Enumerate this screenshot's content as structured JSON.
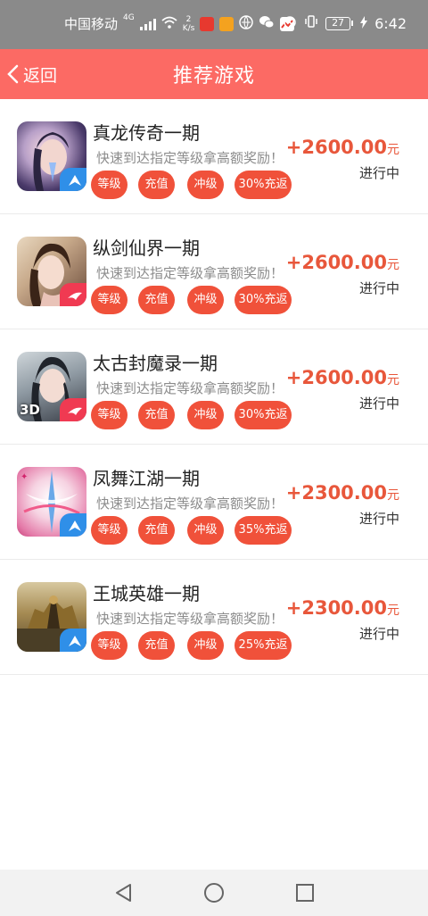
{
  "status_bar": {
    "carrier": "中国移动",
    "network": "4G",
    "speed_value": "2",
    "speed_unit": "K/s",
    "battery": "27",
    "time": "6:42"
  },
  "header": {
    "back_label": "返回",
    "title": "推荐游戏"
  },
  "games": [
    {
      "name": "真龙传奇一期",
      "desc": "快速到达指定等级拿高额奖励！",
      "tags": [
        "等级",
        "充值",
        "冲级",
        "30%充返"
      ],
      "amount": "+2600.00",
      "unit": "元",
      "status": "进行中"
    },
    {
      "name": "纵剑仙界一期",
      "desc": "快速到达指定等级拿高额奖励！",
      "tags": [
        "等级",
        "充值",
        "冲级",
        "30%充返"
      ],
      "amount": "+2600.00",
      "unit": "元",
      "status": "进行中"
    },
    {
      "name": "太古封魔录一期",
      "desc": "快速到达指定等级拿高额奖励！",
      "tags": [
        "等级",
        "充值",
        "冲级",
        "30%充返"
      ],
      "amount": "+2600.00",
      "unit": "元",
      "status": "进行中",
      "icon_badge": "3D"
    },
    {
      "name": "凤舞江湖一期",
      "desc": "快速到达指定等级拿高额奖励！",
      "tags": [
        "等级",
        "充值",
        "冲级",
        "35%充返"
      ],
      "amount": "+2300.00",
      "unit": "元",
      "status": "进行中"
    },
    {
      "name": "王城英雄一期",
      "desc": "快速到达指定等级拿高额奖励！",
      "tags": [
        "等级",
        "充值",
        "冲级",
        "25%充返"
      ],
      "amount": "+2300.00",
      "unit": "元",
      "status": "进行中"
    }
  ],
  "colors": {
    "header_bg": "#fc6a64",
    "tag_bg": "#f0513a",
    "amount": "#e8573b",
    "status_bar_bg": "#8a8a8a"
  },
  "icons": {
    "back": "chevron-left-icon",
    "nav_back": "triangle-back-icon",
    "nav_home": "circle-home-icon",
    "nav_recent": "square-recent-icon"
  }
}
